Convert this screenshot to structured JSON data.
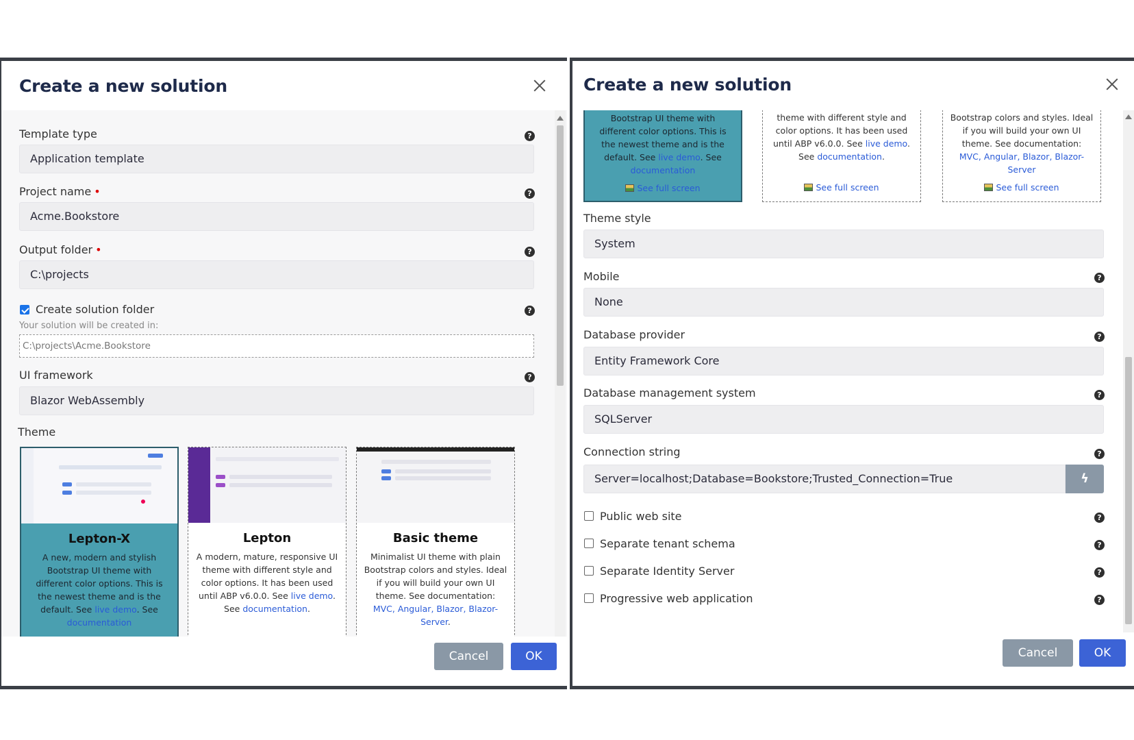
{
  "left": {
    "title": "Create a new solution",
    "template_type": {
      "label": "Template type",
      "value": "Application template"
    },
    "project_name": {
      "label": "Project name",
      "value": "Acme.Bookstore"
    },
    "output_folder": {
      "label": "Output folder",
      "value": "C:\\projects"
    },
    "create_folder": {
      "label": "Create solution folder",
      "checked": true
    },
    "created_in_label": "Your solution will be created in:",
    "created_in_path": "C:\\projects\\Acme.Bookstore",
    "ui_framework": {
      "label": "UI framework",
      "value": "Blazor WebAssembly"
    },
    "theme_label": "Theme",
    "themes": [
      {
        "name": "Lepton-X",
        "desc_before": "A new, modern and stylish Bootstrap UI theme with different color options. This is the newest theme and is the default. See ",
        "link1": "live demo",
        "mid": ". See ",
        "link2": "documentation",
        "after": "."
      },
      {
        "name": "Lepton",
        "desc_before": "A modern, mature, responsive UI theme with different style and color options. It has been used until ABP v6.0.0. See ",
        "link1": "live demo",
        "mid": ". See ",
        "link2": "documentation",
        "after": "."
      },
      {
        "name": "Basic theme",
        "desc_before": "Minimalist UI theme with plain Bootstrap colors and styles. Ideal if you will build your own UI theme. See documentation: ",
        "link1": "MVC, Angular, Blazor, Blazor-Server",
        "mid": "",
        "link2": "",
        "after": "."
      }
    ],
    "cancel": "Cancel",
    "ok": "OK"
  },
  "right": {
    "title": "Create a new solution",
    "card1_text": "Bootstrap UI theme with different color options. This is the newest theme and is the default. See ",
    "card1_link1": "live demo",
    "card1_mid": ". See ",
    "card1_link2": "documentation",
    "card2_text": "theme with different style and color options. It has been used until ABP v6.0.0. See ",
    "card2_link1": "live demo",
    "card2_mid": ". See ",
    "card2_link2": "documentation",
    "card3_text": "Bootstrap colors and styles. Ideal if you will build your own UI theme. See documentation: ",
    "card3_link": "MVC, Angular, Blazor, Blazor-Server",
    "see_full_screen": "See full screen",
    "theme_style": {
      "label": "Theme style",
      "value": "System"
    },
    "mobile": {
      "label": "Mobile",
      "value": "None"
    },
    "database_provider": {
      "label": "Database provider",
      "value": "Entity Framework Core"
    },
    "dbms": {
      "label": "Database management system",
      "value": "SQLServer"
    },
    "connection_string": {
      "label": "Connection string",
      "value": "Server=localhost;Database=Bookstore;Trusted_Connection=True"
    },
    "options": [
      {
        "label": "Public web site",
        "checked": false
      },
      {
        "label": "Separate tenant schema",
        "checked": false
      },
      {
        "label": "Separate Identity Server",
        "checked": false
      },
      {
        "label": "Progressive web application",
        "checked": false
      }
    ],
    "cancel": "Cancel",
    "ok": "OK"
  },
  "colors": {
    "accent": "#3c63d6",
    "selected_card": "#4a9fb0",
    "cancel": "#8a98a6",
    "title": "#1e2a4a"
  },
  "icons": {
    "help": "question-circle-icon",
    "close": "close-icon",
    "generate": "lightning-icon",
    "full_screen": "image-icon"
  }
}
